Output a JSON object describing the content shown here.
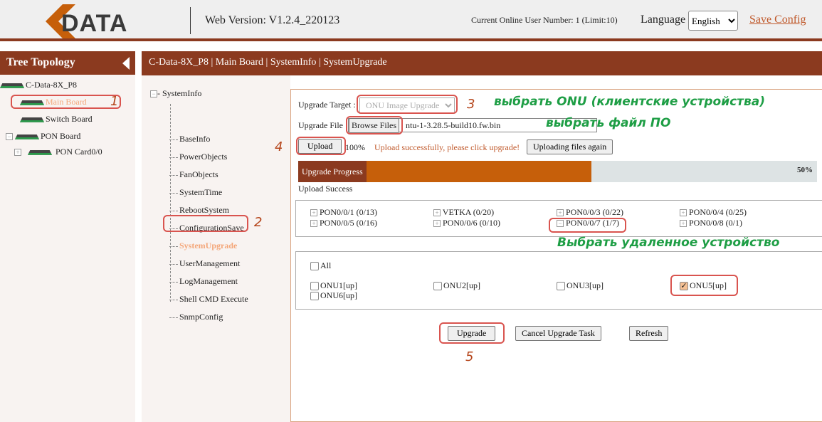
{
  "header": {
    "logo": "CDATA",
    "version": "Web Version: V1.2.4_220123",
    "online": "Current Online User Number: 1 (Limit:10)",
    "language_label": "Language",
    "language_value": "English",
    "save_config": "Save Config"
  },
  "tree": {
    "title": "Tree Topology",
    "nodes": [
      "C-Data-8X_P8",
      "Main Board",
      "Switch Board",
      "PON Board",
      "PON Card0/0"
    ]
  },
  "breadcrumb": "C-Data-8X_P8 | Main Board | SystemInfo | SystemUpgrade",
  "nav": {
    "root": "SystemInfo",
    "items": [
      "BaseInfo",
      "PowerObjects",
      "FanObjects",
      "SystemTime",
      "RebootSystem",
      "ConfigurationSave",
      "SystemUpgrade",
      "UserManagement",
      "LogManagement",
      "Shell CMD Execute",
      "SnmpConfig"
    ]
  },
  "form": {
    "target_label": "Upgrade Target :",
    "target_value": "ONU Image Upgrade",
    "file_label": "Upgrade File",
    "browse": "Browse Files",
    "file_value": "ntu-1-3.28.5-build10.fw.bin",
    "upload": "Upload",
    "upload_pct": "100%",
    "upload_msg": "Upload successfully, please click upgrade!",
    "upload_again": "Uploading files again",
    "progress_label": "Upgrade Progress",
    "progress_pct": "50%",
    "progress_value": 50,
    "status": "Upload Success"
  },
  "pons": [
    "PON0/0/1 (0/13)",
    "VETKA (0/20)",
    "PON0/0/3 (0/22)",
    "PON0/0/4 (0/25)",
    "PON0/0/5 (0/16)",
    "PON0/0/6 (0/10)",
    "PON0/0/7 (1/7)",
    "PON0/0/8 (0/1)"
  ],
  "onus": {
    "all": "All",
    "items": [
      "ONU1[up]",
      "ONU2[up]",
      "ONU3[up]",
      "ONU5[up]",
      "ONU6[up]"
    ]
  },
  "actions": {
    "upgrade": "Upgrade",
    "cancel": "Cancel Upgrade Task",
    "refresh": "Refresh"
  },
  "annotations": {
    "n1": "1",
    "n2": "2",
    "n3": "3",
    "n4": "4",
    "n5": "5",
    "note_onu": "выбрать ONU (клиентские устройства)",
    "note_file": "выбрать файл ПО",
    "note_remote": "Выбрать удаленное устройство"
  },
  "colors": {
    "brand": "#8b3a1f",
    "progress": "#c65f0a"
  }
}
